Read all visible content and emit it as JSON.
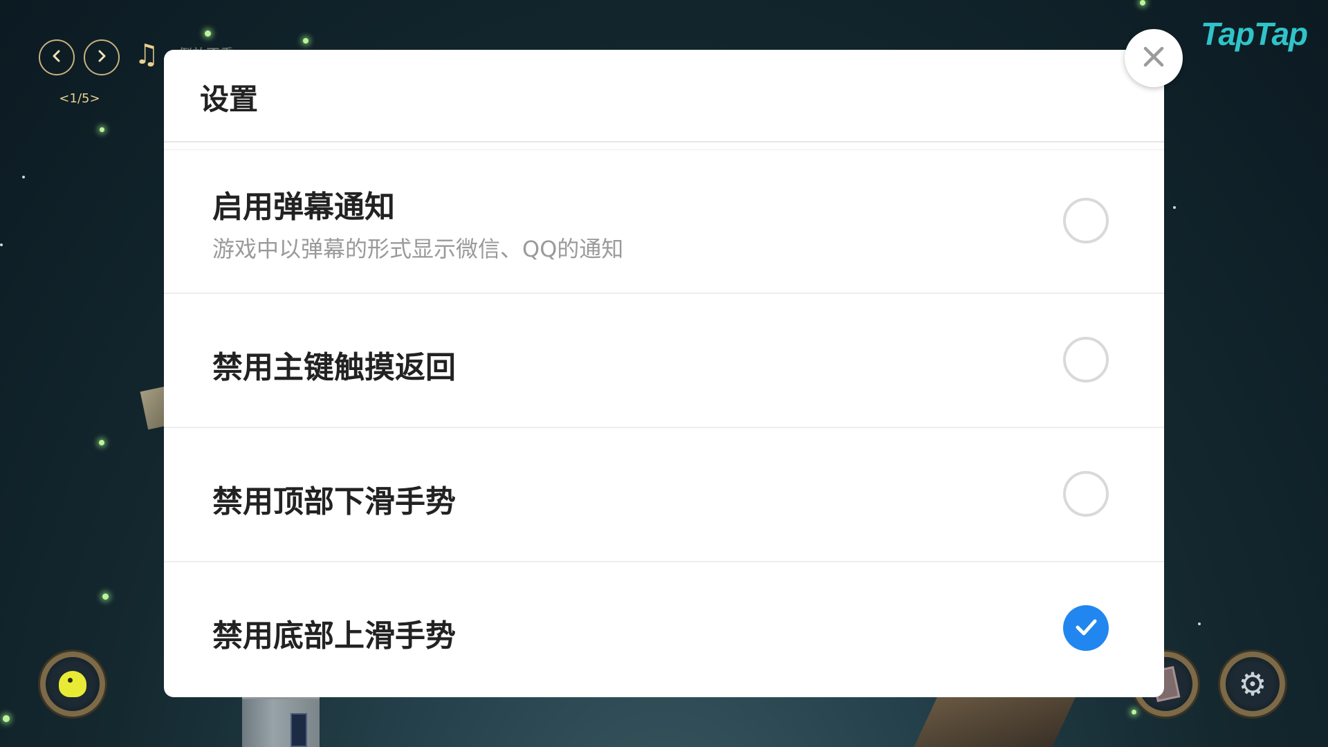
{
  "hud": {
    "prev_icon": "chevron-left-icon",
    "next_icon": "chevron-right-icon",
    "music_icon": "music-note-icon",
    "music_glyph": "♫",
    "track_title": "倒放不重",
    "page_indicator": "<1/5>",
    "logo_text": "TapTap"
  },
  "dialog": {
    "title": "设置",
    "settings": [
      {
        "label": "启用弹幕通知",
        "description": "游戏中以弹幕的形式显示微信、QQ的通知",
        "checked": false
      },
      {
        "label": "禁用主键触摸返回",
        "checked": false
      },
      {
        "label": "禁用顶部下滑手势",
        "checked": false
      },
      {
        "label": "禁用底部上滑手势",
        "checked": true
      }
    ]
  },
  "colors": {
    "accent_checked": "#2186f0",
    "logo": "#2fc4c9",
    "hud_gold": "#c8b27b"
  }
}
